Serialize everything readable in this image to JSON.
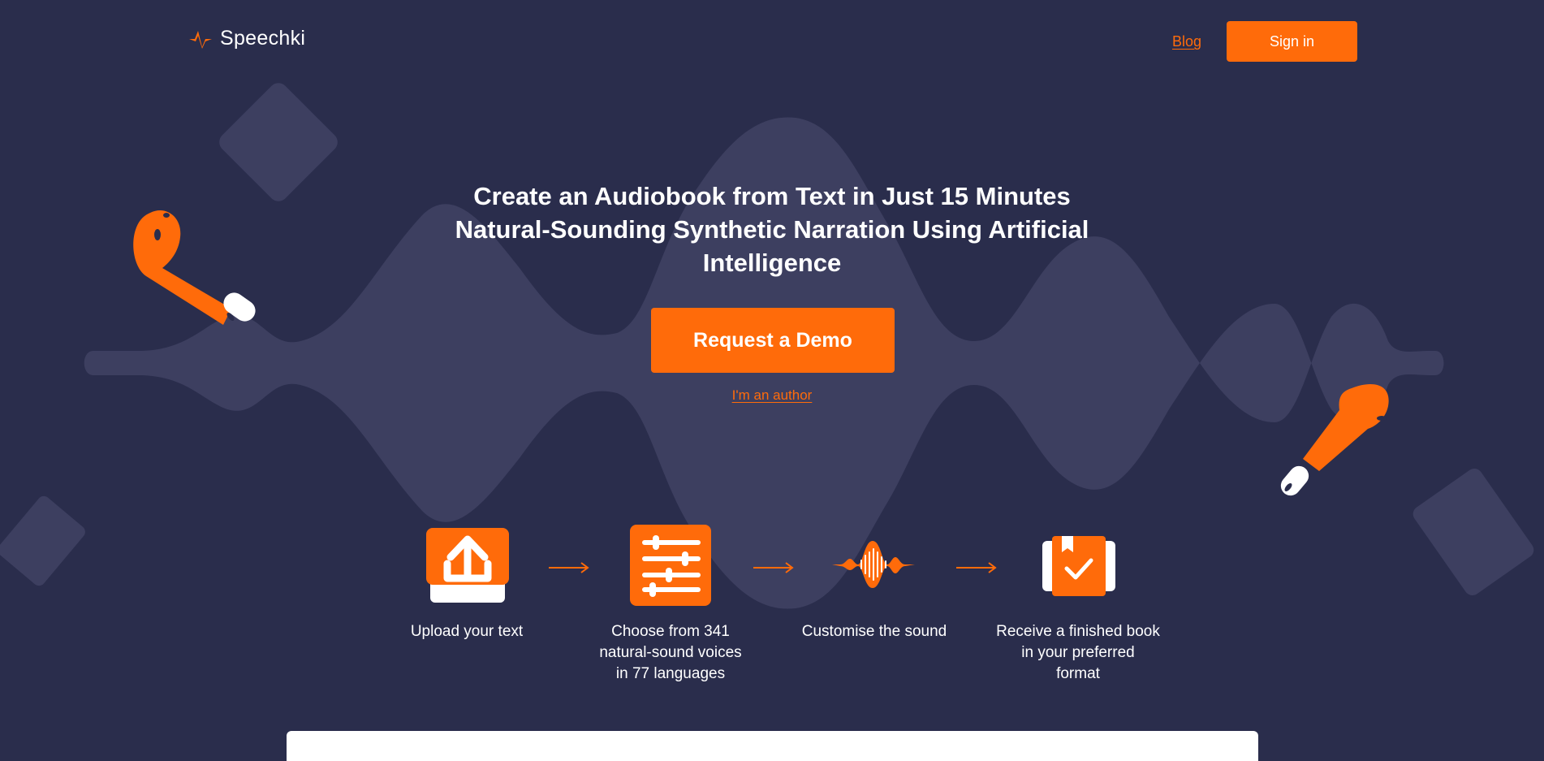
{
  "brand": {
    "name": "Speechki",
    "accent": "#ff6b0a",
    "background": "#2a2d4c",
    "wave": "#3d3f60"
  },
  "nav": {
    "blog": "Blog",
    "signin": "Sign in"
  },
  "hero": {
    "title_line1": "Create an Audiobook from Text in Just 15 Minutes",
    "title_line2": "Natural-Sounding Synthetic Narration Using Artificial",
    "title_line3": "Intelligence",
    "cta": "Request a Demo",
    "author_link": "I'm an author"
  },
  "steps": [
    {
      "icon": "upload-icon",
      "line1": "Upload your text",
      "line2": "",
      "line3": ""
    },
    {
      "icon": "sliders-icon",
      "line1": "Choose from 341",
      "line2": "natural-sound voices",
      "line3": "in 77 languages"
    },
    {
      "icon": "soundwave-icon",
      "line1": "Customise the sound",
      "line2": "",
      "line3": ""
    },
    {
      "icon": "book-check-icon",
      "line1": "Receive a finished book",
      "line2": "in your preferred",
      "line3": "format"
    }
  ]
}
